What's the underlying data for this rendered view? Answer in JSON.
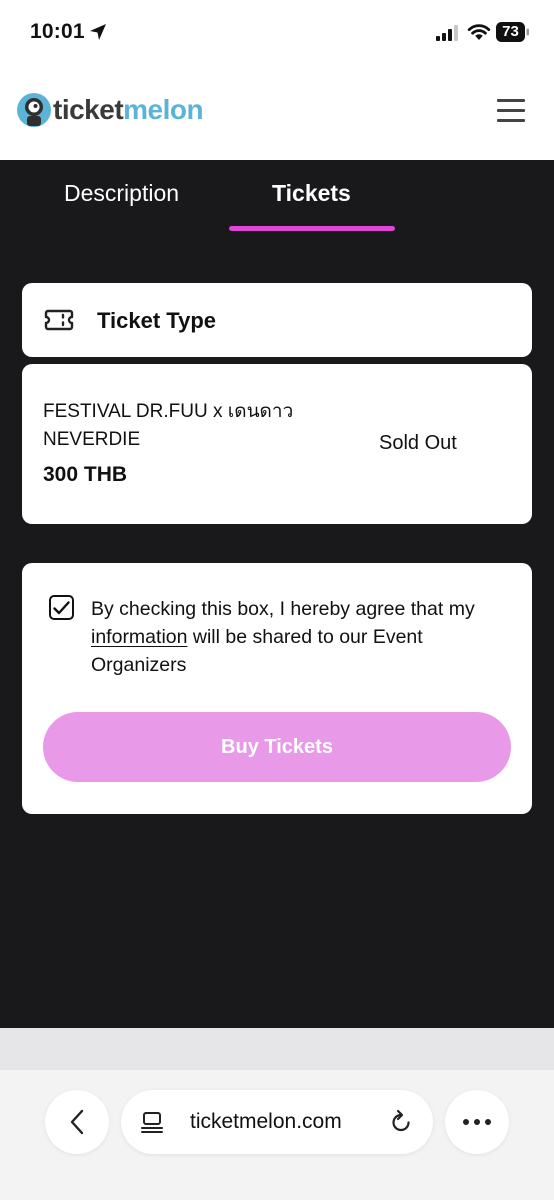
{
  "status_bar": {
    "time": "10:01",
    "battery": "73"
  },
  "header": {
    "logo_part1": "ticket",
    "logo_part2": "melon",
    "menu_icon": "hamburger-icon"
  },
  "tabs": [
    {
      "label": "Description",
      "active": false
    },
    {
      "label": "Tickets",
      "active": true
    }
  ],
  "ticket_type_card": {
    "title": "Ticket Type",
    "icon": "ticket-icon"
  },
  "ticket_item": {
    "name": "FESTIVAL DR.FUU x เดนดาว NEVERDIE",
    "price": "300 THB",
    "status": "Sold Out"
  },
  "consent": {
    "checked": true,
    "text_before": "By checking this box, I hereby agree that my ",
    "link_text": "information",
    "text_after": " will be shared to our Event Organizers"
  },
  "buy_button": {
    "label": "Buy Tickets"
  },
  "browser": {
    "url": "ticketmelon.com"
  },
  "colors": {
    "accent": "#e046d8",
    "button_disabled": "#e89ae8",
    "dark_background": "#19191b",
    "logo_blue": "#5bb4d6"
  }
}
